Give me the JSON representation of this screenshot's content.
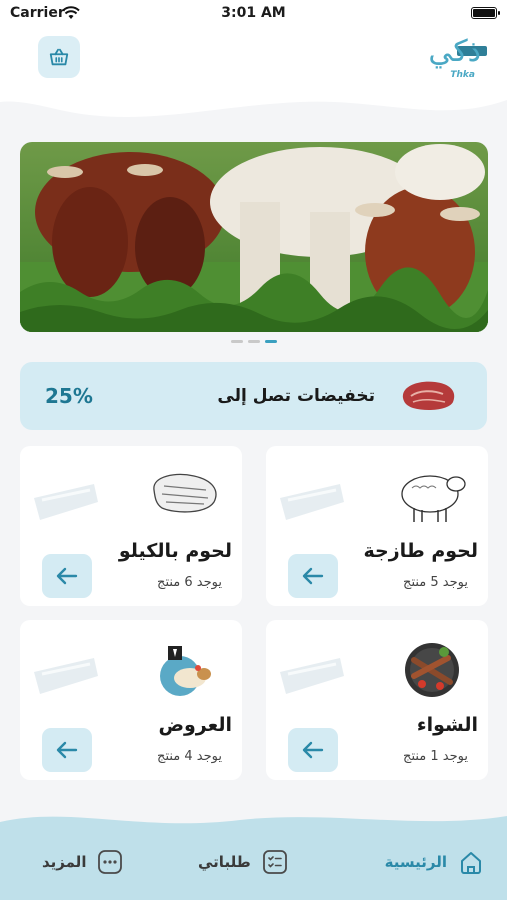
{
  "status_bar": {
    "carrier": "Carrier",
    "time": "3:01 AM"
  },
  "header": {
    "logo_text": "ذكي",
    "logo_latin": "Thka"
  },
  "banner": {
    "slides": 3,
    "active_slide": 3
  },
  "promo": {
    "label": "تخفيضات تصل إلى",
    "percent": "25%"
  },
  "categories": [
    {
      "title": "لحوم طازجة",
      "count": "يوجد 5 منتج",
      "icon": "sheep-icon"
    },
    {
      "title": "لحوم بالكيلو",
      "count": "يوجد 6 منتج",
      "icon": "meat-cut-icon"
    },
    {
      "title": "الشواء",
      "count": "يوجد 1 منتج",
      "icon": "grill-plate-icon"
    },
    {
      "title": "العروض",
      "count": "يوجد 4 منتج",
      "icon": "offers-icon"
    }
  ],
  "nav": {
    "home": "الرئيسية",
    "orders": "طلباتي",
    "more": "المزيد"
  },
  "colors": {
    "accent": "#2a89a8",
    "light_accent": "#d4ebf3"
  }
}
